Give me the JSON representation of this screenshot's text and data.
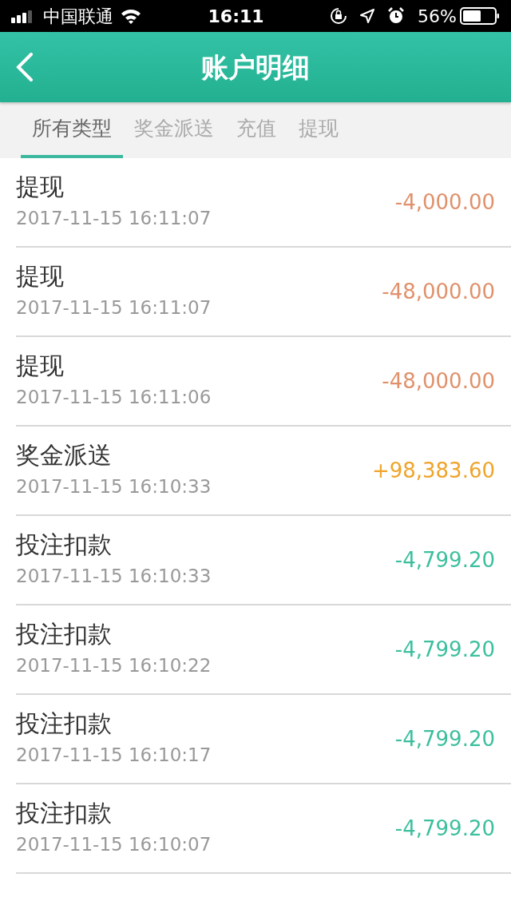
{
  "status_bar": {
    "carrier": "中国联通",
    "time": "16:11",
    "battery": "56%"
  },
  "header": {
    "title": "账户明细"
  },
  "tabs": [
    {
      "label": "所有类型",
      "selected": true
    },
    {
      "label": "奖金派送",
      "selected": false
    },
    {
      "label": "充值",
      "selected": false
    },
    {
      "label": "提现",
      "selected": false
    }
  ],
  "records": [
    {
      "title": "提现",
      "time": "2017-11-15 16:11:07",
      "amount": "-4,000.00",
      "color": "#e0916c"
    },
    {
      "title": "提现",
      "time": "2017-11-15 16:11:07",
      "amount": "-48,000.00",
      "color": "#e0916c"
    },
    {
      "title": "提现",
      "time": "2017-11-15 16:11:06",
      "amount": "-48,000.00",
      "color": "#e0916c"
    },
    {
      "title": "奖金派送",
      "time": "2017-11-15 16:10:33",
      "amount": "+98,383.60",
      "color": "#efa42a"
    },
    {
      "title": "投注扣款",
      "time": "2017-11-15 16:10:33",
      "amount": "-4,799.20",
      "color": "#3dbf9e"
    },
    {
      "title": "投注扣款",
      "time": "2017-11-15 16:10:22",
      "amount": "-4,799.20",
      "color": "#3dbf9e"
    },
    {
      "title": "投注扣款",
      "time": "2017-11-15 16:10:17",
      "amount": "-4,799.20",
      "color": "#3dbf9e"
    },
    {
      "title": "投注扣款",
      "time": "2017-11-15 16:10:07",
      "amount": "-4,799.20",
      "color": "#3dbf9e"
    }
  ]
}
